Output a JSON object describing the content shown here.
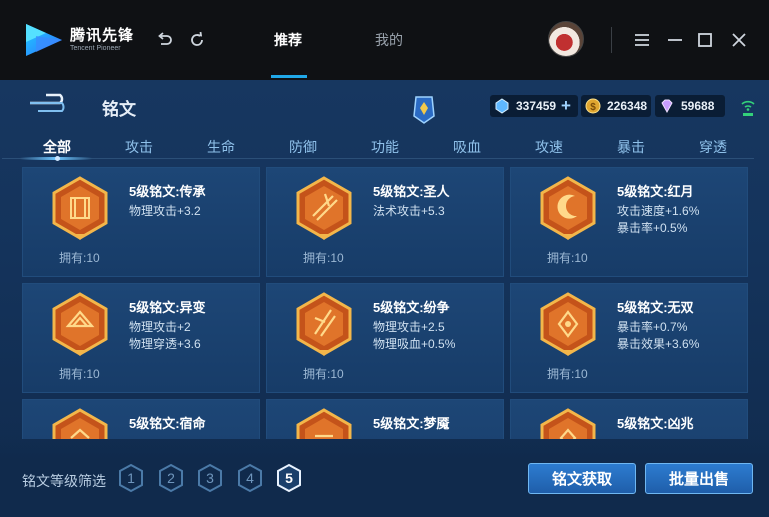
{
  "header": {
    "logo_cn": "腾讯先锋",
    "logo_en": "Tencent Pioneer",
    "tabs": [
      {
        "label": "推荐",
        "active": true
      },
      {
        "label": "我的",
        "active": false
      }
    ],
    "accent": "#20a8e8"
  },
  "page": {
    "title": "铭文",
    "currencies": [
      {
        "icon": "diamond-icon",
        "value": "337459",
        "has_plus": true
      },
      {
        "icon": "gold-coin-icon",
        "value": "226348",
        "has_plus": false
      },
      {
        "icon": "gem-icon",
        "value": "59688",
        "has_plus": false
      }
    ]
  },
  "categories": [
    "全部",
    "攻击",
    "生命",
    "防御",
    "功能",
    "吸血",
    "攻速",
    "暴击",
    "穿透"
  ],
  "active_category": "全部",
  "cards": [
    {
      "name": "5级铭文:传承",
      "attrs": [
        "物理攻击+3.2"
      ],
      "owned": "拥有:10"
    },
    {
      "name": "5级铭文:圣人",
      "attrs": [
        "法术攻击+5.3"
      ],
      "owned": "拥有:10"
    },
    {
      "name": "5级铭文:红月",
      "attrs": [
        "攻击速度+1.6%",
        "暴击率+0.5%"
      ],
      "owned": "拥有:10"
    },
    {
      "name": "5级铭文:异变",
      "attrs": [
        "物理攻击+2",
        "物理穿透+3.6"
      ],
      "owned": "拥有:10"
    },
    {
      "name": "5级铭文:纷争",
      "attrs": [
        "物理攻击+2.5",
        "物理吸血+0.5%"
      ],
      "owned": "拥有:10"
    },
    {
      "name": "5级铭文:无双",
      "attrs": [
        "暴击率+0.7%",
        "暴击效果+3.6%"
      ],
      "owned": "拥有:10"
    },
    {
      "name": "5级铭文:宿命",
      "attrs": [],
      "owned": ""
    },
    {
      "name": "5级铭文:梦魇",
      "attrs": [],
      "owned": ""
    },
    {
      "name": "5级铭文:凶兆",
      "attrs": [],
      "owned": ""
    }
  ],
  "footer": {
    "filter_label": "铭文等级筛选",
    "levels": [
      "1",
      "2",
      "3",
      "4",
      "5"
    ],
    "active_level": "5",
    "obtain_button": "铭文获取",
    "batch_sell_button": "批量出售"
  }
}
